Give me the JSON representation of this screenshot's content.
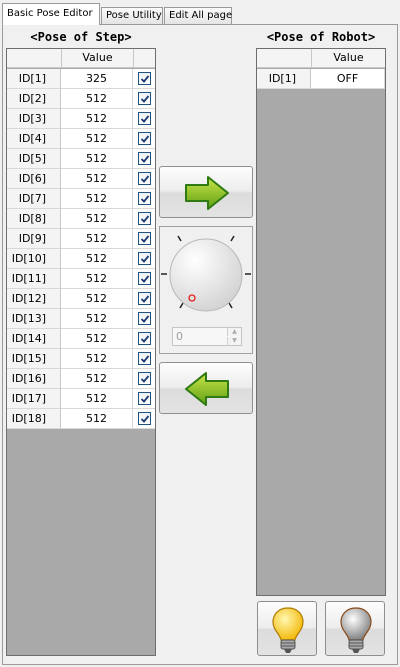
{
  "tabs": [
    {
      "label": "Basic Pose Editor",
      "active": true
    },
    {
      "label": "Pose Utility",
      "active": false
    },
    {
      "label": "Edit All page",
      "active": false
    }
  ],
  "step_panel": {
    "title": "<Pose of Step>",
    "column_header": "Value",
    "rows": [
      {
        "id": "ID[1]",
        "value": "325",
        "checked": true
      },
      {
        "id": "ID[2]",
        "value": "512",
        "checked": true
      },
      {
        "id": "ID[3]",
        "value": "512",
        "checked": true
      },
      {
        "id": "ID[4]",
        "value": "512",
        "checked": true
      },
      {
        "id": "ID[5]",
        "value": "512",
        "checked": true
      },
      {
        "id": "ID[6]",
        "value": "512",
        "checked": true
      },
      {
        "id": "ID[7]",
        "value": "512",
        "checked": true
      },
      {
        "id": "ID[8]",
        "value": "512",
        "checked": true
      },
      {
        "id": "ID[9]",
        "value": "512",
        "checked": true
      },
      {
        "id": "ID[10]",
        "value": "512",
        "checked": true
      },
      {
        "id": "ID[11]",
        "value": "512",
        "checked": true
      },
      {
        "id": "ID[12]",
        "value": "512",
        "checked": true
      },
      {
        "id": "ID[13]",
        "value": "512",
        "checked": true
      },
      {
        "id": "ID[14]",
        "value": "512",
        "checked": true
      },
      {
        "id": "ID[15]",
        "value": "512",
        "checked": true
      },
      {
        "id": "ID[16]",
        "value": "512",
        "checked": true
      },
      {
        "id": "ID[17]",
        "value": "512",
        "checked": true
      },
      {
        "id": "ID[18]",
        "value": "512",
        "checked": true
      }
    ]
  },
  "robot_panel": {
    "title": "<Pose of Robot>",
    "column_header": "Value",
    "rows": [
      {
        "id": "ID[1]",
        "value": "OFF"
      }
    ]
  },
  "controls": {
    "dial_value": "0",
    "copy_to_robot_icon": "arrow-right-icon",
    "copy_to_step_icon": "arrow-left-icon",
    "torque_on_icon": "lightbulb-on-icon",
    "torque_off_icon": "lightbulb-off-icon",
    "arrow_color": "#7fb321",
    "arrow_outline": "#2f7a12",
    "bulb_on_color": "#f7c10f",
    "bulb_off_color": "#8a8a8a"
  }
}
